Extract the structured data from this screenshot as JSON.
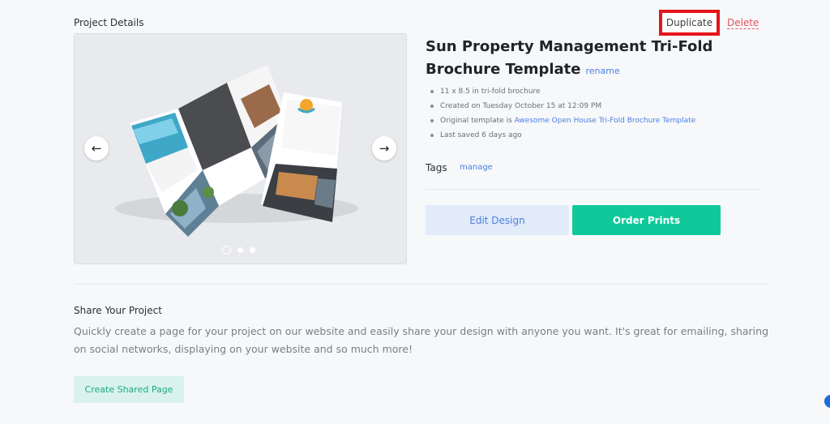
{
  "header": {
    "section_title": "Project Details",
    "duplicate_label": "Duplicate",
    "delete_label": "Delete"
  },
  "carousel": {
    "prev_icon": "arrow-left-icon",
    "next_icon": "arrow-right-icon",
    "slide_count": 3,
    "active_slide": 1,
    "brochure": {
      "headline": "Let us help you rent out your house like royalty.",
      "panel_title": "Ownership Solutions",
      "list_items": [
        "Property Maintenance",
        "Marketing & Tenant Screening",
        "Rent Collection"
      ],
      "extra_title": "Outstanding Tenants",
      "brand_name": "Sun Properties"
    }
  },
  "project": {
    "title": "Sun Property Management Tri-Fold Brochure Template",
    "rename_label": "rename",
    "meta": {
      "size": "11 x 8.5 in tri-fold brochure",
      "created": "Created on Tuesday October 15 at 12:09 PM",
      "original_prefix": "Original template is ",
      "original_link": "Awesome Open House Tri-Fold Brochure Template",
      "saved": "Last saved 6 days ago"
    },
    "tags_label": "Tags",
    "manage_label": "manage",
    "edit_label": "Edit Design",
    "order_label": "Order Prints"
  },
  "share": {
    "title": "Share Your Project",
    "description": "Quickly create a page for your project on our website and easily share your design with anyone you want. It's great for emailing, sharing on social networks, displaying on your website and so much more!",
    "button_label": "Create Shared Page"
  },
  "colors": {
    "accent_green": "#10c99a",
    "link_blue": "#4a7fe0",
    "danger_red": "#e0555a",
    "highlight_red": "#e5141b"
  }
}
